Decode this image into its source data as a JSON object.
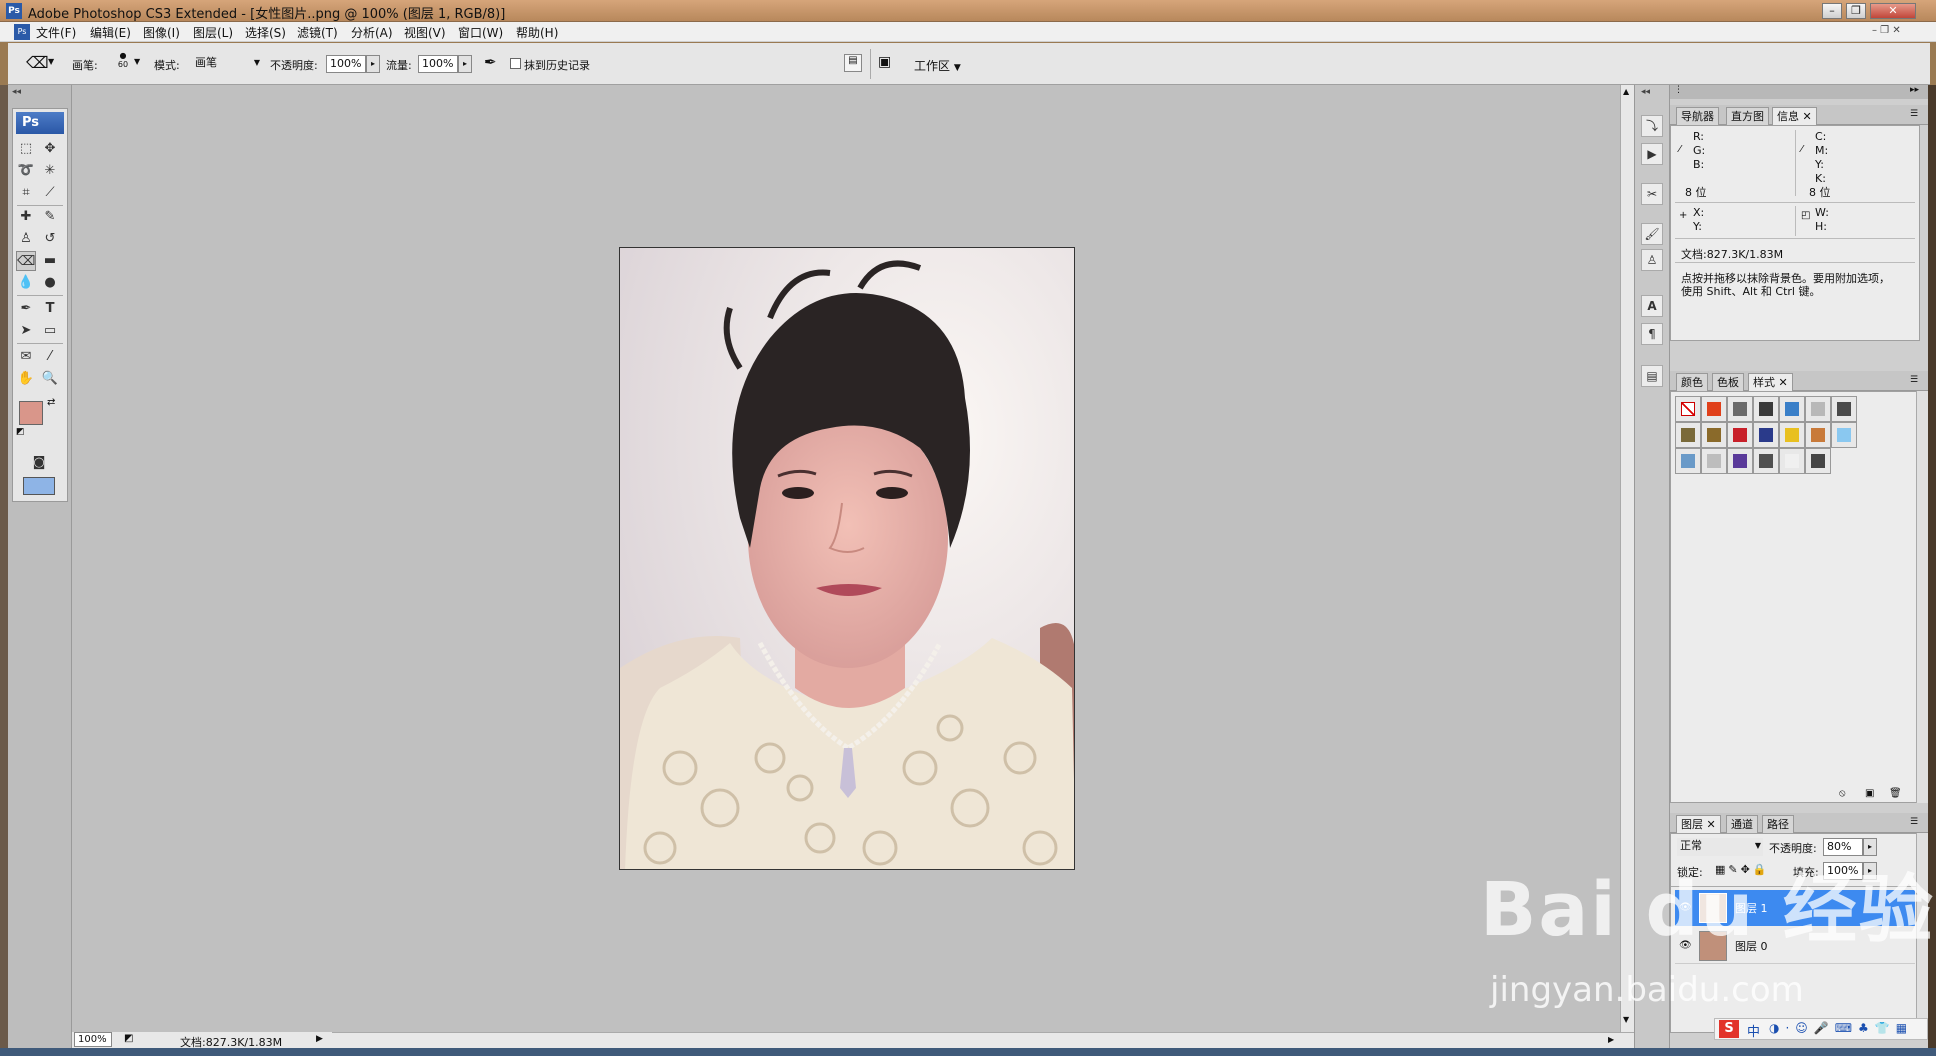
{
  "window": {
    "title": "Adobe Photoshop CS3 Extended - [女性图片..png @ 100% (图层 1, RGB/8)]",
    "app_icon": "Ps"
  },
  "menu": [
    "文件(F)",
    "编辑(E)",
    "图像(I)",
    "图层(L)",
    "选择(S)",
    "滤镜(T)",
    "分析(A)",
    "视图(V)",
    "窗口(W)",
    "帮助(H)"
  ],
  "options": {
    "brush_label": "画笔:",
    "brush_size": "60",
    "mode_label": "模式:",
    "mode_value": "画笔",
    "opacity_label": "不透明度:",
    "opacity_value": "100%",
    "flow_label": "流量:",
    "flow_value": "100%",
    "erase_history_label": "抹到历史记录",
    "workspace_label": "工作区"
  },
  "toolbox": {
    "logo": "Ps",
    "foreground_color": "#d9968a",
    "background_color": "#ffffff"
  },
  "info_panel": {
    "tabs": [
      "导航器",
      "直方图",
      "信息"
    ],
    "rgb": [
      "R:",
      "G:",
      "B:"
    ],
    "cmyk": [
      "C:",
      "M:",
      "Y:",
      "K:"
    ],
    "bits_left": "8 位",
    "bits_right": "8 位",
    "xy": [
      "X:",
      "Y:"
    ],
    "wh": [
      "W:",
      "H:"
    ],
    "doc": "文档:827.3K/1.83M",
    "hint_line1": "点按并拖移以抹除背景色。要用附加选项，",
    "hint_line2": "使用 Shift、Alt 和 Ctrl 键。"
  },
  "styles_panel": {
    "tabs": [
      "颜色",
      "色板",
      "样式"
    ],
    "swatches": [
      "#ffffff",
      "#e0401a",
      "#6a6a6a",
      "#3a3a3a",
      "#3a7fc8",
      "#b8b8b8",
      "#4a4a4a",
      "#7a6a3a",
      "#8a6a2a",
      "#c8202a",
      "#2a3a8a",
      "#e8c020",
      "#c87a3a",
      "#8ac8f0",
      "#6a9ac8",
      "#bdbdbd",
      "#5a3a9a",
      "#505050",
      "#f0f0f0",
      "#454545"
    ]
  },
  "layers_panel": {
    "tabs": [
      "图层",
      "通道",
      "路径"
    ],
    "blend_mode": "正常",
    "opacity_label": "不透明度:",
    "opacity_value": "80%",
    "lock_label": "锁定:",
    "fill_label": "填充:",
    "fill_value": "100%",
    "layers": [
      {
        "name": "图层 1",
        "selected": true
      },
      {
        "name": "图层 0",
        "selected": false
      }
    ]
  },
  "status": {
    "zoom": "100%",
    "doc": "文档:827.3K/1.83M"
  },
  "watermark": {
    "line1": "Bai du 经验",
    "line2": "jingyan.baidu.com"
  },
  "ime": {
    "label": "中"
  }
}
